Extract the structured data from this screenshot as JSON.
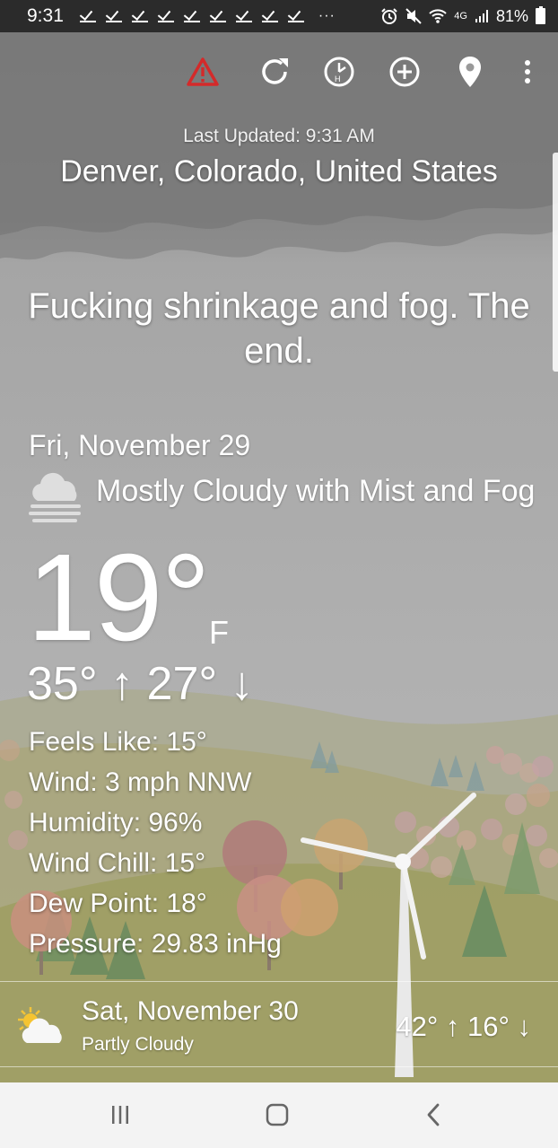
{
  "status_bar": {
    "time": "9:31",
    "dots": "···",
    "network": "4G",
    "battery": "81%"
  },
  "toolbar": {
    "icons": [
      "alert-icon",
      "refresh-icon",
      "history-clock-icon",
      "add-location-icon",
      "location-pin-icon",
      "overflow-menu-icon"
    ],
    "alert_color": "#d42a2a"
  },
  "header": {
    "last_updated": "Last Updated: 9:31 AM",
    "location": "Denver, Colorado, United States"
  },
  "quote": "Fucking shrinkage and fog. The end.",
  "today": {
    "date": "Fri, November 29",
    "condition": "Mostly Cloudy with Mist and Fog",
    "condition_icon": "cloud-fog-icon",
    "temperature": "19°",
    "unit": "F",
    "hilo": "35° ↑ 27° ↓"
  },
  "details": {
    "feels_like": "Feels Like: 15°",
    "wind": "Wind: 3 mph NNW",
    "humidity": "Humidity: 96%",
    "wind_chill": "Wind Chill: 15°",
    "dew_point": "Dew Point: 18°",
    "pressure": "Pressure: 29.83 inHg"
  },
  "forecast": [
    {
      "date": "Sat, November 30",
      "condition": "Partly Cloudy",
      "icon": "partly-cloudy-icon",
      "hilo": "42° ↑ 16° ↓"
    }
  ],
  "navbar": {
    "icons": [
      "recent-apps-icon",
      "home-icon",
      "back-icon"
    ]
  }
}
